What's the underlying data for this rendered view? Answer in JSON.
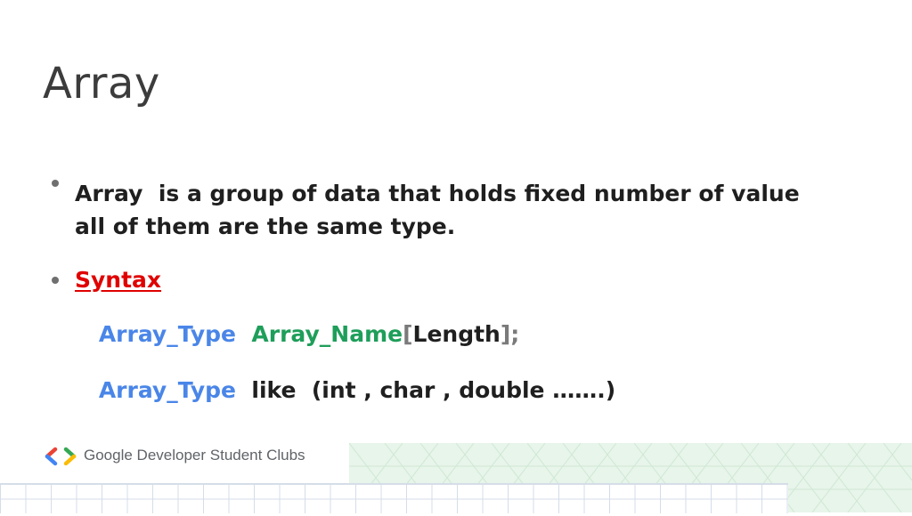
{
  "slide": {
    "title": "Array"
  },
  "bullets": {
    "definition": {
      "keyword": "Array",
      "line1_rest": "  is a group of data that holds fixed number of value",
      "line2": "all of them are the same type."
    },
    "syntax": {
      "label": "Syntax",
      "declaration": {
        "type": "Array_Type",
        "gap": "  ",
        "name": "Array_Name",
        "open_bracket": "[",
        "length": "Length",
        "close": "];"
      },
      "example": {
        "type": "Array_Type",
        "rest": "  like  (int , char , double …….)"
      }
    }
  },
  "footer": {
    "brand": "Google Developer Student Clubs",
    "logo_icon": "gdsc-brackets-logo-icon"
  },
  "colors": {
    "syntax_label": "#e00000",
    "type_blue": "#4a86e8",
    "name_green": "#1e9e5a",
    "bracket_gray": "#7a7a7a"
  }
}
